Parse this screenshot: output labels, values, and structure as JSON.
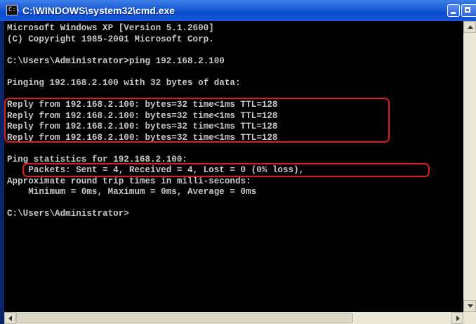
{
  "window": {
    "title": "C:\\WINDOWS\\system32\\cmd.exe",
    "icon": "cmd-prompt-icon",
    "icon_glyph": "C:\\",
    "controls": [
      "minimize-icon",
      "maximize-icon"
    ]
  },
  "console": {
    "text_color": "#c8c8c8",
    "background": "#000000",
    "highlight_color": "#d81e1e",
    "lines": [
      "Microsoft Windows XP [Version 5.1.2600]",
      "(C) Copyright 1985-2001 Microsoft Corp.",
      "",
      "C:\\Users\\Administrator>ping 192.168.2.100",
      "",
      "Pinging 192.168.2.100 with 32 bytes of data:",
      "",
      "Reply from 192.168.2.100: bytes=32 time<1ms TTL=128",
      "Reply from 192.168.2.100: bytes=32 time<1ms TTL=128",
      "Reply from 192.168.2.100: bytes=32 time<1ms TTL=128",
      "Reply from 192.168.2.100: bytes=32 time<1ms TTL=128",
      "",
      "Ping statistics for 192.168.2.100:",
      "    Packets: Sent = 4, Received = 4, Lost = 0 (0% loss),",
      "Approximate round trip times in milli-seconds:",
      "    Minimum = 0ms, Maximum = 0ms, Average = 0ms",
      "",
      "C:\\Users\\Administrator>"
    ]
  }
}
